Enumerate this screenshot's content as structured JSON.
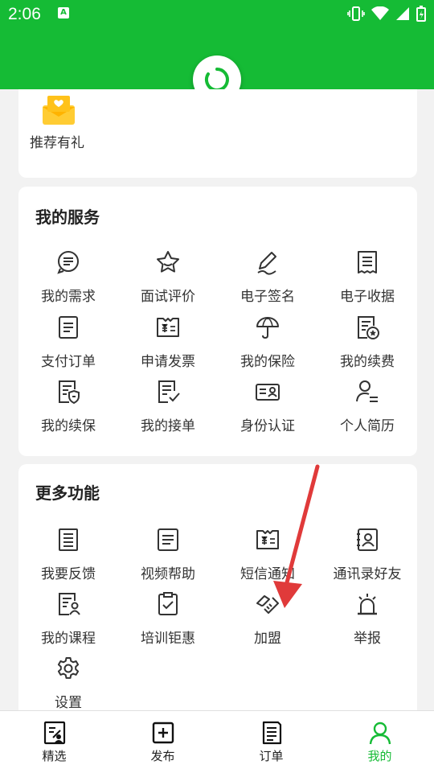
{
  "status_bar": {
    "time": "2:06",
    "notification_badge": "A"
  },
  "colors": {
    "brand": "#15bb35",
    "icon": "#333333",
    "arrow": "#e03a3a"
  },
  "top_card": {
    "item_label": "推荐有礼"
  },
  "services": {
    "title": "我的服务",
    "items": [
      "我的需求",
      "面试评价",
      "电子签名",
      "电子收据",
      "支付订单",
      "申请发票",
      "我的保险",
      "我的续费",
      "我的续保",
      "我的接单",
      "身份认证",
      "个人简历"
    ]
  },
  "more": {
    "title": "更多功能",
    "items": [
      "我要反馈",
      "视频帮助",
      "短信通知",
      "通讯录好友",
      "我的课程",
      "培训钜惠",
      "加盟",
      "举报",
      "设置"
    ]
  },
  "tabbar": {
    "tabs": [
      "精选",
      "发布",
      "订单",
      "我的"
    ],
    "active": "我的"
  }
}
